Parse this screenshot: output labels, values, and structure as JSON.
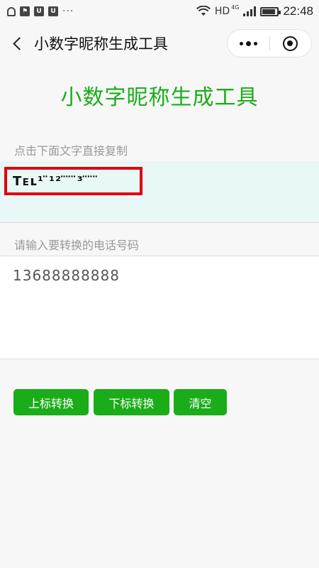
{
  "status_bar": {
    "time": "22:48",
    "network": "HD",
    "network_gen": "4G",
    "dots": "···"
  },
  "nav": {
    "title": "小数字昵称生成工具"
  },
  "page": {
    "heading": "小数字昵称生成工具",
    "copy_hint": "点击下面文字直接复制",
    "result_text": "Tᴇʟ¹ ̈¹² ̈ ̈ ̈³ ̈ ̈ ̈",
    "input_label": "请输入要转换的电话号码",
    "phone_value": "13688888888"
  },
  "buttons": {
    "superscript": "上标转换",
    "subscript": "下标转换",
    "clear": "清空"
  },
  "colors": {
    "accent": "#1aad19",
    "highlight_border": "#e0000e",
    "result_bg": "#e8f8f6"
  }
}
